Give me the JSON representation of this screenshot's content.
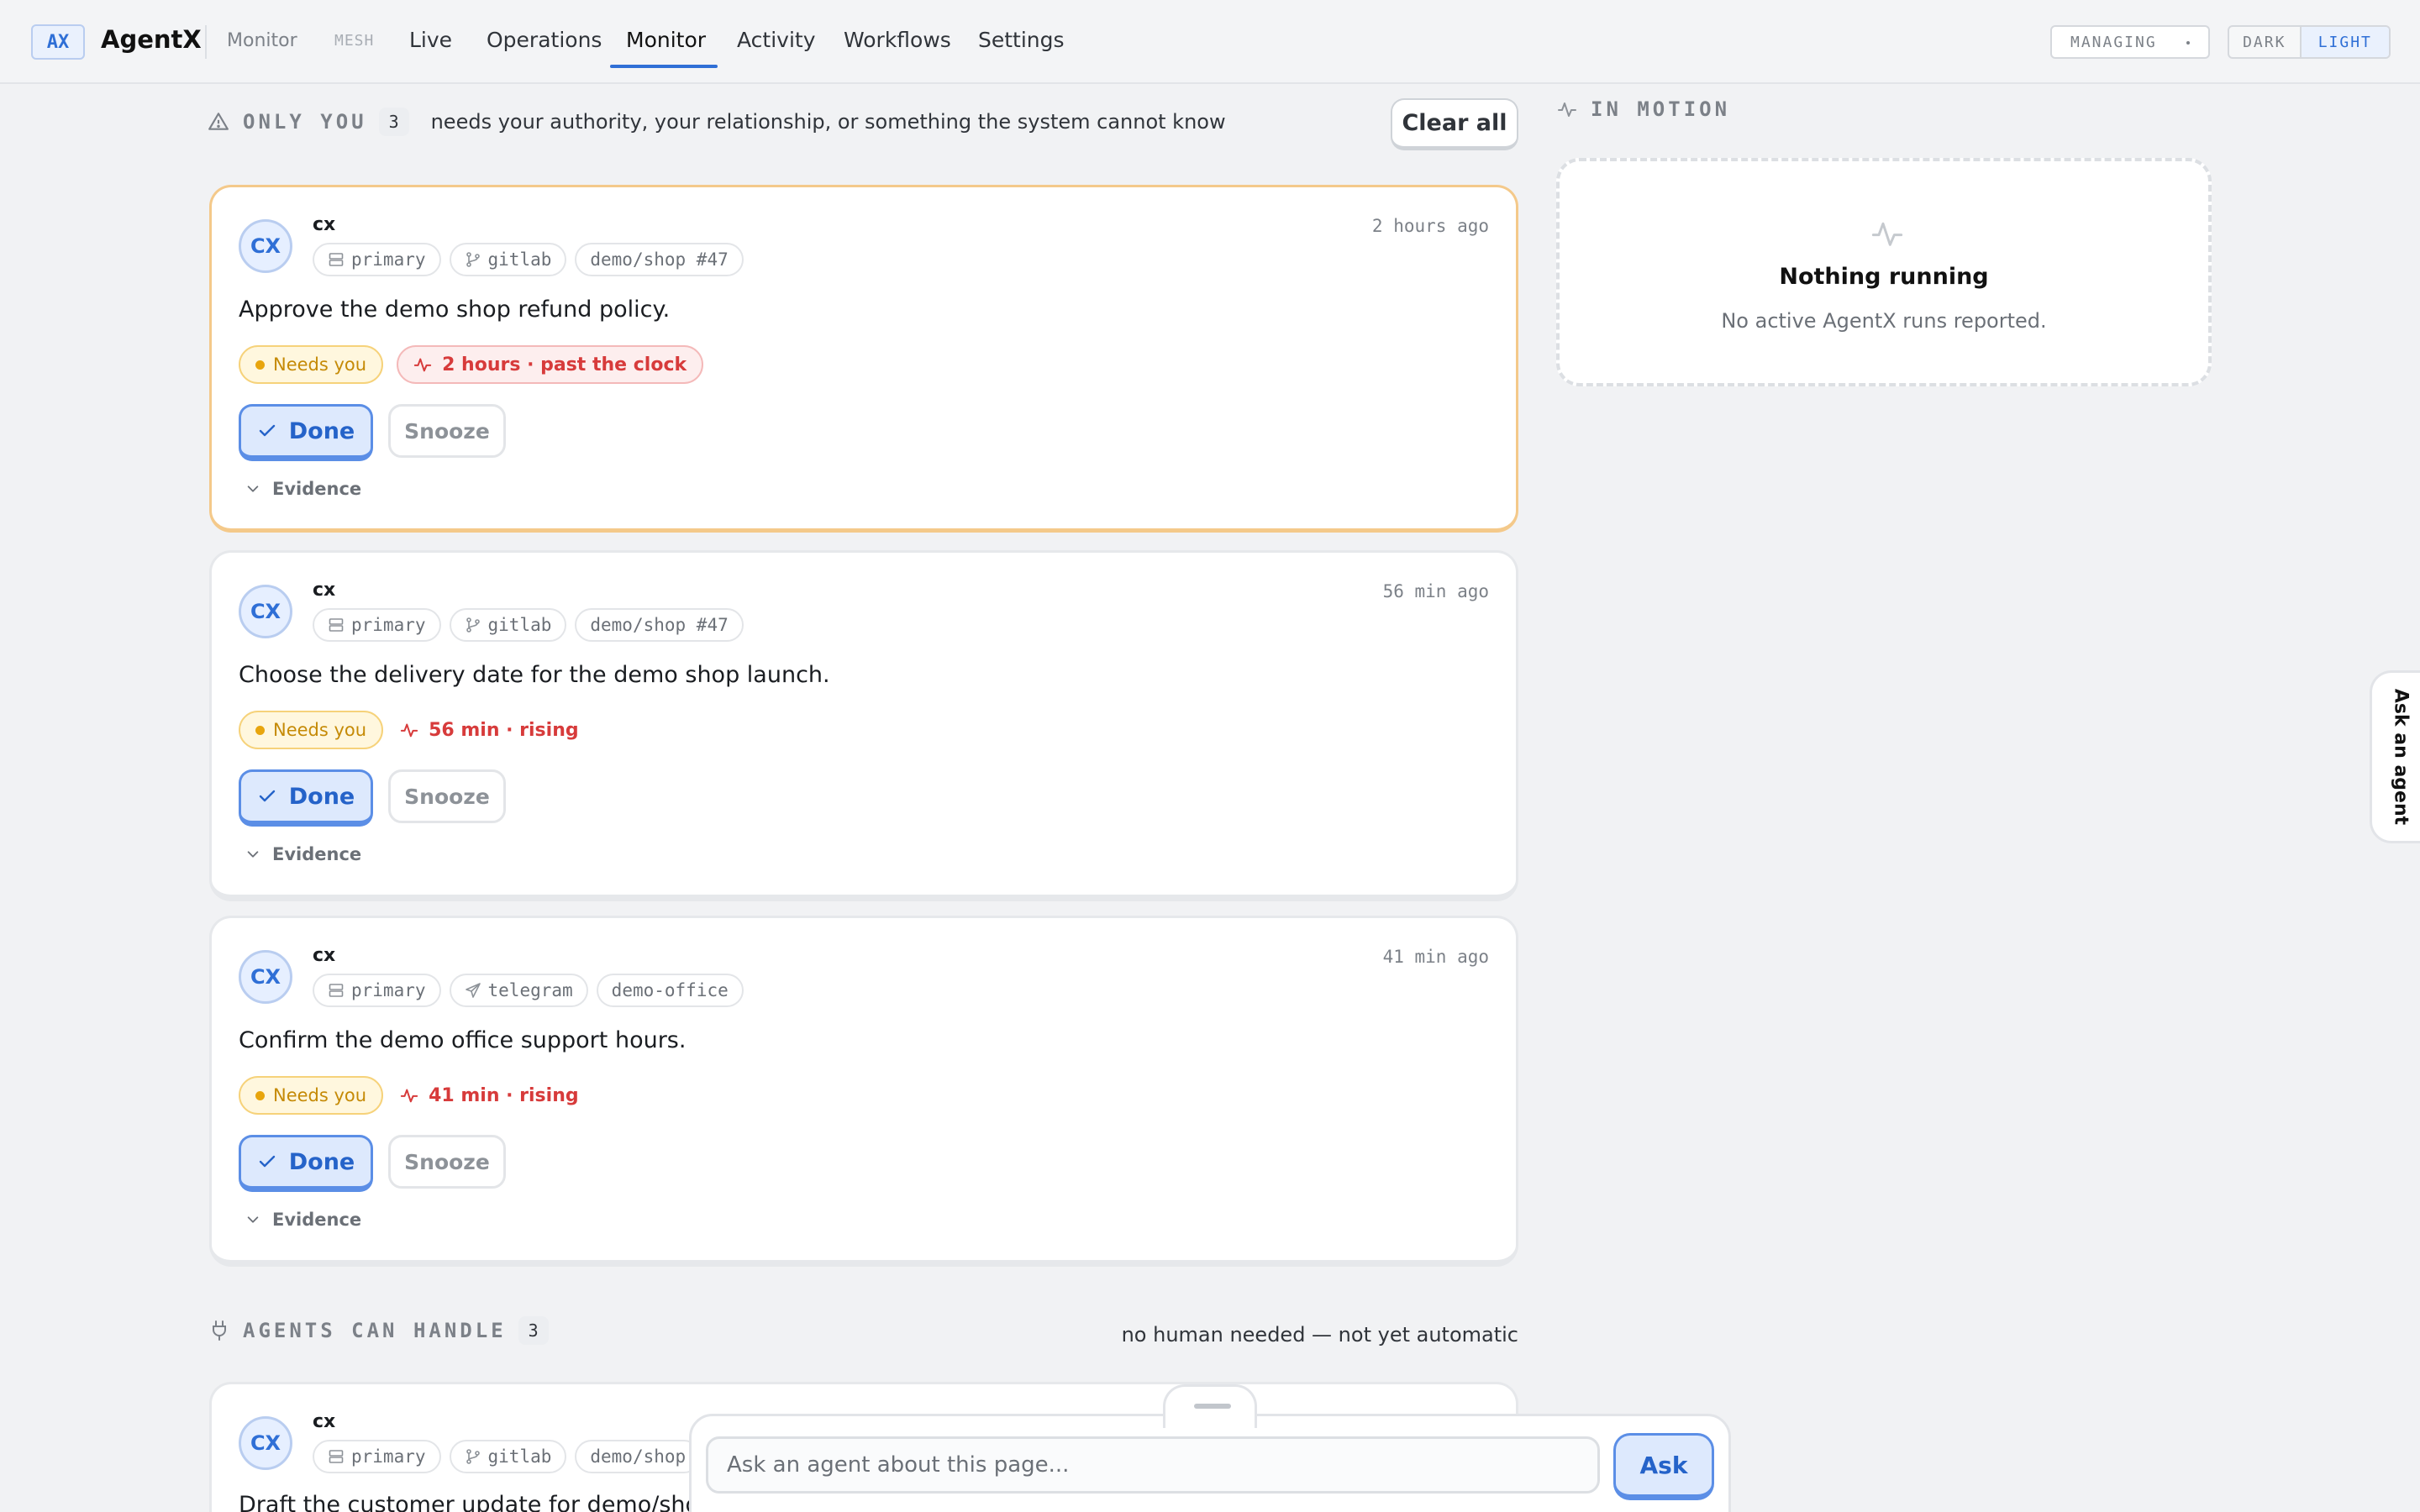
{
  "nav": {
    "logo": "AX",
    "brand": "AgentX",
    "crumb": "Monitor",
    "mesh": "MESH",
    "tabs": [
      "Live",
      "Operations",
      "Monitor",
      "Activity",
      "Workflows",
      "Settings"
    ],
    "active_tab": "Monitor",
    "managing": "MANAGING",
    "theme": {
      "dark": "DARK",
      "light": "LIGHT",
      "selected": "LIGHT"
    }
  },
  "only_you": {
    "title": "ONLY YOU",
    "count": "3",
    "description": "needs your authority, your relationship, or something the system cannot know",
    "clear_all": "Clear all",
    "cards": [
      {
        "avatar": "CX",
        "who": "cx",
        "when": "2 hours ago",
        "tags": [
          {
            "icon": "server-icon",
            "label": "primary"
          },
          {
            "icon": "git-branch-icon",
            "label": "gitlab"
          },
          {
            "icon": "",
            "label": "demo/shop #47"
          }
        ],
        "task": "Approve the demo shop refund policy.",
        "status": "Needs you",
        "urgency": "2 hours · past the clock",
        "done": "Done",
        "snooze": "Snooze",
        "evidence": "Evidence"
      },
      {
        "avatar": "CX",
        "who": "cx",
        "when": "56 min ago",
        "tags": [
          {
            "icon": "server-icon",
            "label": "primary"
          },
          {
            "icon": "git-branch-icon",
            "label": "gitlab"
          },
          {
            "icon": "",
            "label": "demo/shop #47"
          }
        ],
        "task": "Choose the delivery date for the demo shop launch.",
        "status": "Needs you",
        "urgency": "56 min · rising",
        "done": "Done",
        "snooze": "Snooze",
        "evidence": "Evidence"
      },
      {
        "avatar": "CX",
        "who": "cx",
        "when": "41 min ago",
        "tags": [
          {
            "icon": "server-icon",
            "label": "primary"
          },
          {
            "icon": "send-icon",
            "label": "telegram"
          },
          {
            "icon": "",
            "label": "demo-office"
          }
        ],
        "task": "Confirm the demo office support hours.",
        "status": "Needs you",
        "urgency": "41 min · rising",
        "done": "Done",
        "snooze": "Snooze",
        "evidence": "Evidence"
      }
    ]
  },
  "agents_can_handle": {
    "title": "AGENTS CAN HANDLE",
    "count": "3",
    "description": "no human needed — not yet automatic",
    "cards": [
      {
        "avatar": "CX",
        "who": "cx",
        "tags": [
          {
            "icon": "server-icon",
            "label": "primary"
          },
          {
            "icon": "git-branch-icon",
            "label": "gitlab"
          },
          {
            "icon": "",
            "label": "demo/shop"
          }
        ],
        "task": "Draft the customer update for demo/shop N"
      }
    ]
  },
  "in_motion": {
    "title": "IN MOTION",
    "empty_title": "Nothing running",
    "empty_sub": "No active AgentX runs reported."
  },
  "side_tab": "Ask an agent",
  "ask": {
    "placeholder": "Ask an agent about this page...",
    "button": "Ask"
  },
  "colors": {
    "accent": "#2f6fd6",
    "needs_you": "#e8a50d",
    "urgent": "#d73b3b",
    "hot_border": "#f4c98a"
  }
}
